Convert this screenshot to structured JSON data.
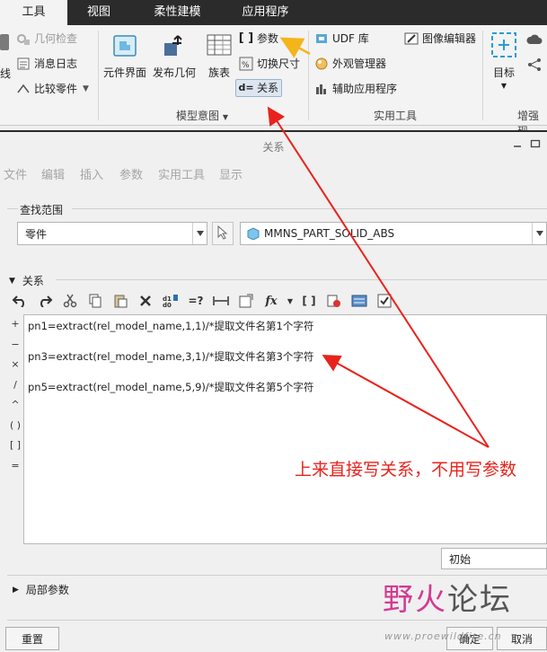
{
  "ribbon": {
    "tabs": [
      {
        "label": "工具",
        "active": true
      },
      {
        "label": "视图",
        "active": false
      },
      {
        "label": "柔性建模",
        "active": false
      },
      {
        "label": "应用程序",
        "active": false
      }
    ],
    "left_partial_label": "线",
    "investigate": {
      "geometry_check": "几何检查",
      "message_log": "消息日志",
      "compare_part": "比较零件"
    },
    "model_intent": {
      "component_interface": "元件界面",
      "publish_geometry": "发布几何",
      "family_table": "族表",
      "parameters": "参数",
      "switch_dimensions": "切换尺寸",
      "relations": "关系",
      "group_label": "模型意图"
    },
    "utilities": {
      "udf_library": "UDF 库",
      "appearance_manager": "外观管理器",
      "auxiliary_apps": "辅助应用程序",
      "image_editor": "图像编辑器",
      "group_label": "实用工具"
    },
    "enhanced": {
      "target": "目标",
      "group_label": "增强现"
    }
  },
  "dialog": {
    "title": "关系",
    "menu": [
      "文件",
      "编辑",
      "插入",
      "参数",
      "实用工具",
      "显示"
    ],
    "lookup_scope": {
      "label": "查找范围",
      "type_value": "零件",
      "model_value": "MMNS_PART_SOLID_ABS"
    },
    "relations_section_label": "关系",
    "side_operators": [
      "+",
      "−",
      "×",
      "/",
      "^",
      "( )",
      "[ ]",
      "="
    ],
    "relations": [
      "pn1=extract(rel_model_name,1,1)/*提取文件名第1个字符",
      "pn3=extract(rel_model_name,3,1)/*提取文件名第3个字符",
      "pn5=extract(rel_model_name,5,9)/*提取文件名第5个字符"
    ],
    "state_value": "初始",
    "local_params_label": "局部参数",
    "buttons": {
      "reset": "重置",
      "ok": "确定",
      "cancel": "取消"
    }
  },
  "annotation": {
    "text": "上来直接写关系，不用写参数",
    "color": "#e8231d"
  },
  "watermark": {
    "logo_part1": "野火",
    "logo_part2": "论坛",
    "url": "www.proewildfire.cn"
  },
  "colors": {
    "ribbon_tab_bar": "#2b2b2b",
    "arrow_yellow": "#f3b51a",
    "annotation_red": "#e8231d"
  }
}
